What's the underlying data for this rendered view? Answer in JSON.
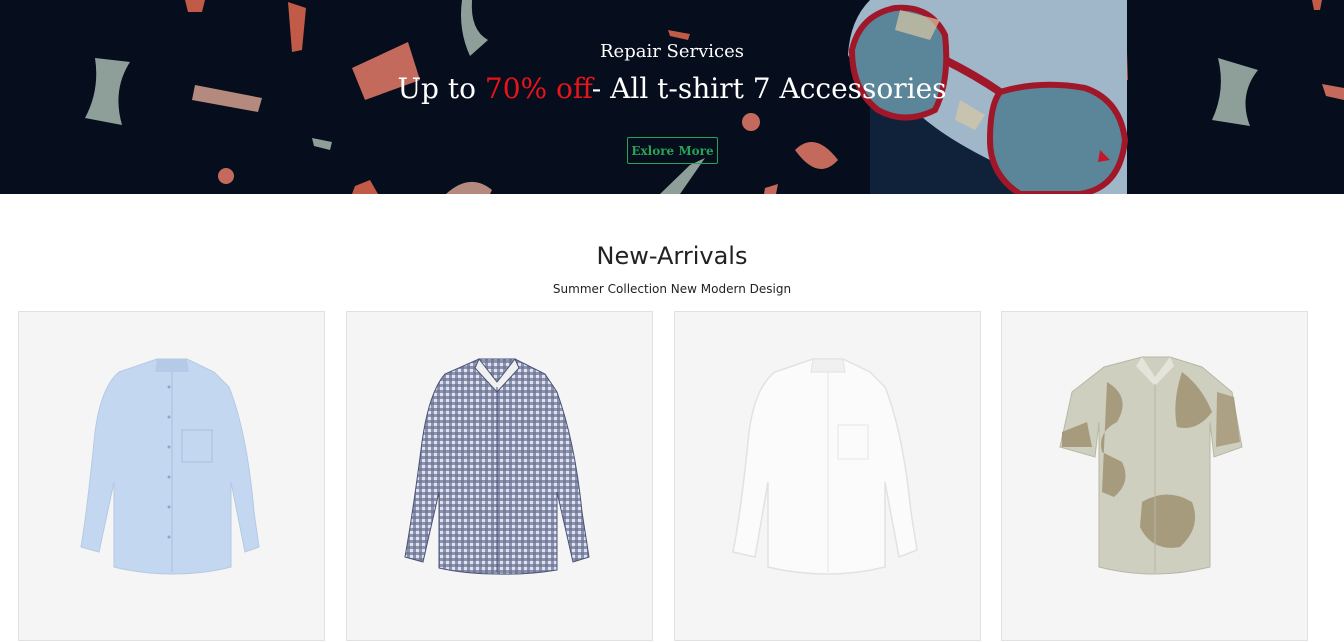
{
  "banner": {
    "subtitle": "Repair Services",
    "title_prefix": "Up to ",
    "title_accent": "70% off",
    "title_suffix": "- All t-shirt 7 Accessories",
    "button_label": "Exlore More",
    "background_color": "#060d1c",
    "accent_color": "#e8141b",
    "button_color": "#26a356"
  },
  "section": {
    "title": "New-Arrivals",
    "subtitle": "Summer Collection New Modern Design"
  },
  "products": [
    {
      "image": "light-blue-band-collar-shirt",
      "color": "#c3d8f0"
    },
    {
      "image": "navy-gingham-shirt",
      "color": "#4a5377"
    },
    {
      "image": "white-band-collar-shirt",
      "color": "#f2f2f2"
    },
    {
      "image": "beige-printed-short-sleeve-shirt",
      "color": "#cfcfc0"
    }
  ]
}
